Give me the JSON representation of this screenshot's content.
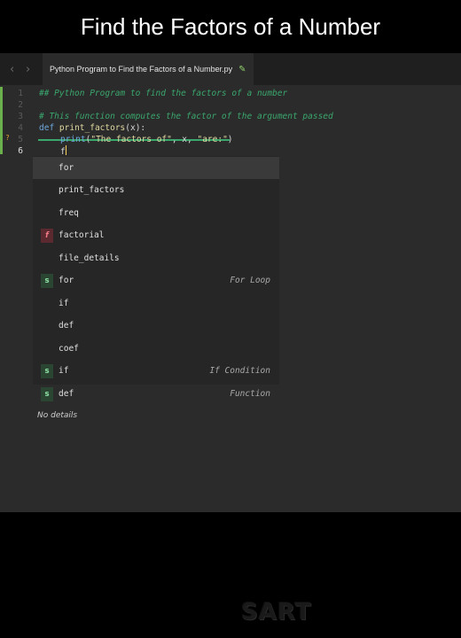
{
  "video_title": "Find the Factors of a Number",
  "tab": {
    "filename": "Python Program to Find the Factors of a Number.py",
    "edit_icon": "pencil-icon"
  },
  "nav": {
    "back_icon": "chevron-left-icon",
    "forward_icon": "chevron-right-icon"
  },
  "gutter": {
    "line_numbers": [
      "1",
      "2",
      "3",
      "4",
      "5",
      "6"
    ],
    "active_line": "6",
    "warning_mark": "?"
  },
  "code": {
    "line1": "## Python Program to find the factors of a number",
    "line3": "# This function computes the factor of the argument passed",
    "line4_kw": "def",
    "line4_name": "print_factors",
    "line4_rest": "(x):",
    "line5_fn": "print",
    "line5_p1": "(",
    "line5_str1": "\"The factors of\"",
    "line5_mid": ", x, ",
    "line5_str2": "\"are:\"",
    "line5_end": ")",
    "line6_typed": "f"
  },
  "autocomplete": {
    "items": [
      {
        "label": "for",
        "badge": "",
        "hint": ""
      },
      {
        "label": "print_factors",
        "badge": "",
        "hint": ""
      },
      {
        "label": "freq",
        "badge": "",
        "hint": ""
      },
      {
        "label": "factorial",
        "badge": "f",
        "hint": ""
      },
      {
        "label": "file_details",
        "badge": "",
        "hint": ""
      },
      {
        "label": "for",
        "badge": "s",
        "hint": "For Loop"
      },
      {
        "label": "if",
        "badge": "",
        "hint": ""
      },
      {
        "label": "def",
        "badge": "",
        "hint": ""
      },
      {
        "label": "coef",
        "badge": "",
        "hint": ""
      },
      {
        "label": "if",
        "badge": "s",
        "hint": "If Condition"
      },
      {
        "label": "def",
        "badge": "s",
        "hint": "Function"
      }
    ],
    "details": "No details"
  },
  "watermark": "SART",
  "colors": {
    "comment": "#3aa76d",
    "keyword": "#6ea7dc",
    "string": "#e0d8a0",
    "editor_bg": "#2b2b2b"
  }
}
